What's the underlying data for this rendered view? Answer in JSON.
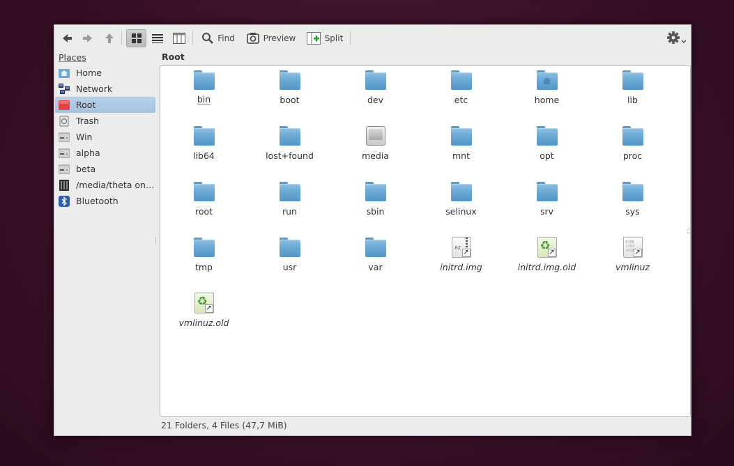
{
  "toolbar": {
    "back_icon": "arrow-left-icon",
    "forward_icon": "arrow-right-icon",
    "up_icon": "arrow-up-icon",
    "view_icons_icon": "grid-icon",
    "view_details_icon": "list-icon",
    "view_columns_icon": "columns-icon",
    "find_label": "Find",
    "preview_label": "Preview",
    "split_label": "Split",
    "menu_icon": "gear-icon"
  },
  "places": {
    "title": "Places",
    "items": [
      {
        "label": "Home",
        "icon": "home-folder-icon"
      },
      {
        "label": "Network",
        "icon": "network-icon"
      },
      {
        "label": "Root",
        "icon": "root-folder-icon",
        "selected": true
      },
      {
        "label": "Trash",
        "icon": "trash-icon"
      },
      {
        "label": "Win",
        "icon": "drive-icon"
      },
      {
        "label": "alpha",
        "icon": "drive-icon"
      },
      {
        "label": "beta",
        "icon": "drive-icon"
      },
      {
        "label": "/media/theta on ...",
        "icon": "device-icon"
      },
      {
        "label": "Bluetooth",
        "icon": "bluetooth-icon"
      }
    ]
  },
  "location": {
    "title": "Root"
  },
  "files": [
    {
      "name": "bin",
      "type": "folder"
    },
    {
      "name": "boot",
      "type": "folder"
    },
    {
      "name": "dev",
      "type": "folder"
    },
    {
      "name": "etc",
      "type": "folder"
    },
    {
      "name": "home",
      "type": "home-folder"
    },
    {
      "name": "lib",
      "type": "folder"
    },
    {
      "name": "lib64",
      "type": "folder"
    },
    {
      "name": "lost+found",
      "type": "folder"
    },
    {
      "name": "media",
      "type": "drive"
    },
    {
      "name": "mnt",
      "type": "folder"
    },
    {
      "name": "opt",
      "type": "folder"
    },
    {
      "name": "proc",
      "type": "folder"
    },
    {
      "name": "root",
      "type": "folder"
    },
    {
      "name": "run",
      "type": "folder"
    },
    {
      "name": "sbin",
      "type": "folder"
    },
    {
      "name": "selinux",
      "type": "folder"
    },
    {
      "name": "srv",
      "type": "folder"
    },
    {
      "name": "sys",
      "type": "folder"
    },
    {
      "name": "tmp",
      "type": "folder"
    },
    {
      "name": "usr",
      "type": "folder"
    },
    {
      "name": "var",
      "type": "folder"
    },
    {
      "name": "initrd.img",
      "type": "gz-link"
    },
    {
      "name": "initrd.img.old",
      "type": "recycle-link"
    },
    {
      "name": "vmlinuz",
      "type": "binary-link"
    },
    {
      "name": "vmlinuz.old",
      "type": "recycle-link"
    }
  ],
  "status": {
    "text": "21 Folders, 4 Files (47,7 MiB)"
  },
  "colors": {
    "accent": "#a5c2e3",
    "folder": "#6eaad6"
  }
}
